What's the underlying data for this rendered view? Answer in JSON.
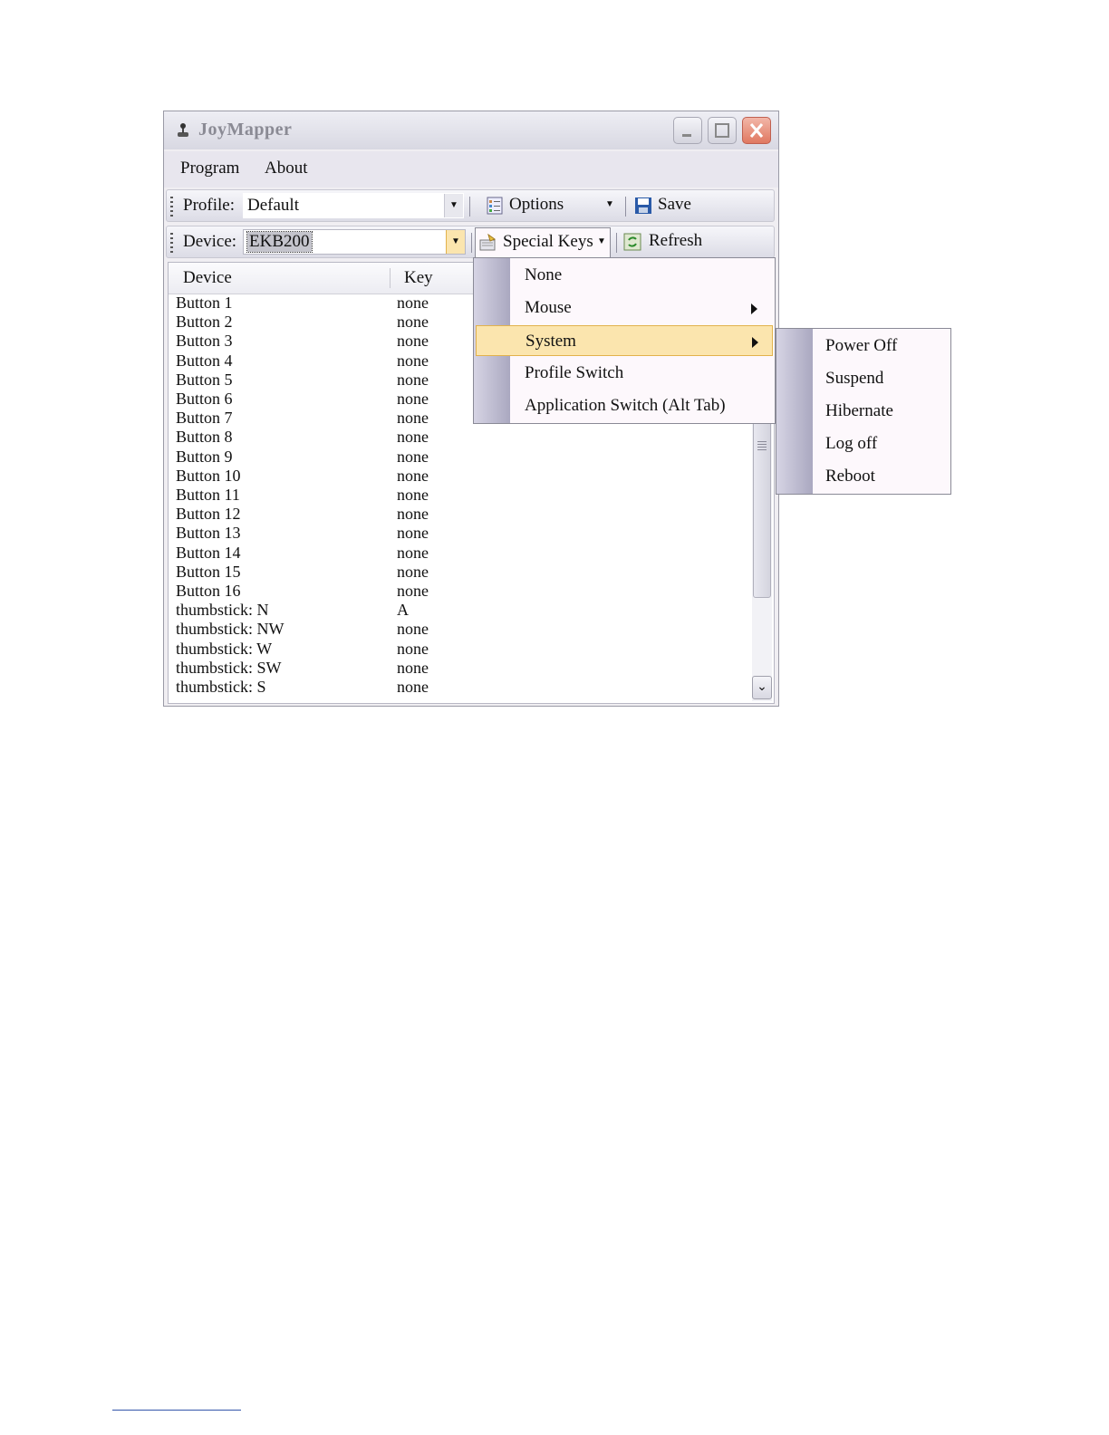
{
  "window": {
    "title": "JoyMapper",
    "colors": {
      "highlight": "#fbe5ae",
      "highlight_border": "#e2b24c",
      "close": "#e07860"
    }
  },
  "menu": {
    "program": "Program",
    "about": "About"
  },
  "toolbar1": {
    "profile_label": "Profile:",
    "profile_value": "Default",
    "options_label": "Options",
    "save_label": "Save"
  },
  "toolbar2": {
    "device_label": "Device:",
    "device_value": "EKB200",
    "special_keys_label": "Special Keys",
    "refresh_label": "Refresh"
  },
  "list": {
    "headers": {
      "device": "Device",
      "key": "Key"
    },
    "rows": [
      {
        "device": "Button 1",
        "key": "none"
      },
      {
        "device": "Button 2",
        "key": "none"
      },
      {
        "device": "Button 3",
        "key": "none"
      },
      {
        "device": "Button 4",
        "key": "none"
      },
      {
        "device": "Button 5",
        "key": "none"
      },
      {
        "device": "Button 6",
        "key": "none"
      },
      {
        "device": "Button 7",
        "key": "none"
      },
      {
        "device": "Button 8",
        "key": "none"
      },
      {
        "device": "Button 9",
        "key": "none"
      },
      {
        "device": "Button 10",
        "key": "none"
      },
      {
        "device": "Button 11",
        "key": "none"
      },
      {
        "device": "Button 12",
        "key": "none"
      },
      {
        "device": "Button 13",
        "key": "none"
      },
      {
        "device": "Button 14",
        "key": "none"
      },
      {
        "device": "Button 15",
        "key": "none"
      },
      {
        "device": "Button 16",
        "key": "none"
      },
      {
        "device": "thumbstick: N",
        "key": "A"
      },
      {
        "device": "thumbstick: NW",
        "key": "none"
      },
      {
        "device": "thumbstick: W",
        "key": "none"
      },
      {
        "device": "thumbstick: SW",
        "key": "none"
      },
      {
        "device": "thumbstick: S",
        "key": "none"
      }
    ]
  },
  "special_keys_menu": {
    "items": [
      {
        "label": "None"
      },
      {
        "label": "Mouse"
      },
      {
        "label": "System"
      },
      {
        "label": "Profile Switch"
      },
      {
        "label": "Application Switch (Alt Tab)"
      }
    ]
  },
  "system_submenu": {
    "items": [
      {
        "label": "Power Off"
      },
      {
        "label": "Suspend"
      },
      {
        "label": "Hibernate"
      },
      {
        "label": "Log off"
      },
      {
        "label": "Reboot"
      }
    ]
  }
}
